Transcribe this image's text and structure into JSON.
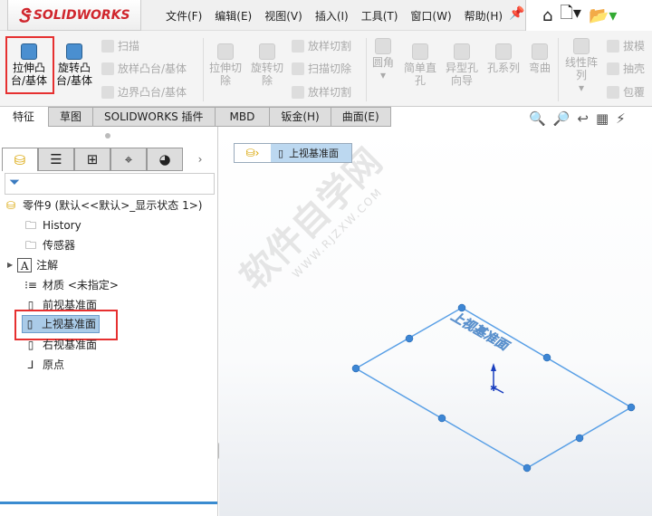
{
  "app": {
    "logo": "SOLIDWORKS",
    "menu": [
      "文件(F)",
      "编辑(E)",
      "视图(V)",
      "插入(I)",
      "工具(T)",
      "窗口(W)",
      "帮助(H)"
    ]
  },
  "ribbon": {
    "big": [
      {
        "label": "拉伸凸台/基体",
        "l1": "拉伸凸",
        "l2": "台/基体"
      },
      {
        "l1": "旋转凸",
        "l2": "台/基体"
      }
    ],
    "small1": [
      "扫描",
      "放样凸台/基体",
      "边界凸台/基体"
    ],
    "cut": [
      {
        "l1": "拉伸切",
        "l2": "除"
      },
      {
        "l1": "旋转切",
        "l2": "除"
      }
    ],
    "small2": [
      "放样切割",
      "扫描切除",
      "放样切割"
    ],
    "feat": [
      {
        "l1": "圆角",
        "l2": ""
      },
      {
        "l1": "简单直",
        "l2": "孔"
      },
      {
        "l1": "异型孔",
        "l2": "向导"
      },
      {
        "l1": "孔系列",
        "l2": ""
      },
      {
        "l1": "弯曲",
        "l2": ""
      },
      {
        "l1": "线性阵",
        "l2": "列"
      }
    ],
    "small3": [
      "拔模",
      "抽壳",
      "包覆"
    ]
  },
  "tabs": [
    "特征",
    "草图",
    "SOLIDWORKS 插件",
    "MBD",
    "钣金(H)",
    "曲面(E)"
  ],
  "tree": {
    "root": "零件9  (默认<<默认>_显示状态 1>)",
    "items": [
      "History",
      "传感器",
      "注解",
      "材质 <未指定>",
      "前视基准面",
      "上视基准面",
      "右视基准面",
      "原点"
    ]
  },
  "breadcrumb": {
    "label": "上视基准面"
  },
  "plane_label": "上视基准面",
  "watermark": {
    "main": "软件自学网",
    "url": "WWW.RJZXW.COM"
  }
}
